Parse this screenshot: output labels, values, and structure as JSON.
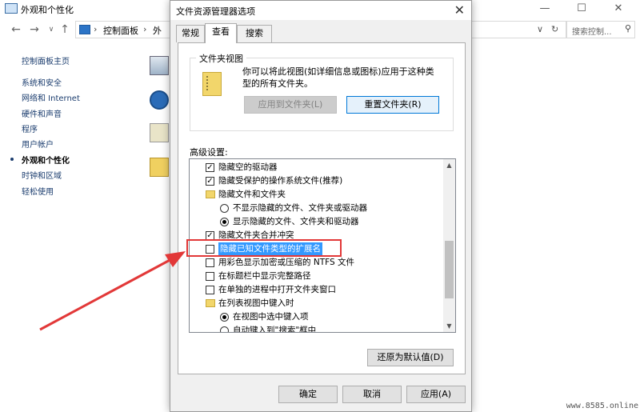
{
  "window": {
    "title": "外观和个性化",
    "minimize": "—",
    "maximize": "☐",
    "close": "✕"
  },
  "nav": {
    "back": "←",
    "forward": "→",
    "recent": "∨",
    "up": "↑",
    "crumbs": [
      "控制面板",
      "外"
    ],
    "refresh": "↻",
    "dropdown": "∨",
    "search_placeholder": "搜索控制...",
    "search_icon": "search-icon"
  },
  "sidebar": {
    "items": [
      {
        "label": "控制面板主页"
      },
      {
        "label": "系统和安全"
      },
      {
        "label": "网络和 Internet"
      },
      {
        "label": "硬件和声音"
      },
      {
        "label": "程序"
      },
      {
        "label": "用户帐户"
      },
      {
        "label": "外观和个性化",
        "active": true
      },
      {
        "label": "时钟和区域"
      },
      {
        "label": "轻松使用"
      }
    ]
  },
  "dialog": {
    "title": "文件资源管理器选项",
    "close": "✕",
    "tabs": [
      {
        "label": "常规"
      },
      {
        "label": "查看",
        "active": true
      },
      {
        "label": "搜索"
      }
    ],
    "folder_views": {
      "legend": "文件夹视图",
      "description": "你可以将此视图(如详细信息或图标)应用于这种类型的所有文件夹。",
      "apply_button": "应用到文件夹(L)",
      "reset_button": "重置文件夹(R)"
    },
    "advanced_label": "高级设置:",
    "settings": [
      {
        "type": "checkbox",
        "checked": true,
        "indent": 0,
        "label": "隐藏空的驱动器"
      },
      {
        "type": "checkbox",
        "checked": true,
        "indent": 0,
        "label": "隐藏受保护的操作系统文件(推荐)"
      },
      {
        "type": "folder",
        "indent": 0,
        "label": "隐藏文件和文件夹"
      },
      {
        "type": "radio",
        "checked": false,
        "indent": 1,
        "label": "不显示隐藏的文件、文件夹或驱动器"
      },
      {
        "type": "radio",
        "checked": true,
        "indent": 1,
        "label": "显示隐藏的文件、文件夹和驱动器"
      },
      {
        "type": "checkbox",
        "checked": true,
        "indent": 0,
        "label": "隐藏文件夹合并冲突"
      },
      {
        "type": "checkbox",
        "checked": false,
        "indent": 0,
        "label": "隐藏已知文件类型的扩展名",
        "selected": true
      },
      {
        "type": "checkbox",
        "checked": false,
        "indent": 0,
        "label": "用彩色显示加密或压缩的 NTFS 文件"
      },
      {
        "type": "checkbox",
        "checked": false,
        "indent": 0,
        "label": "在标题栏中显示完整路径"
      },
      {
        "type": "checkbox",
        "checked": false,
        "indent": 0,
        "label": "在单独的进程中打开文件夹窗口"
      },
      {
        "type": "folder",
        "indent": 0,
        "label": "在列表视图中键入时"
      },
      {
        "type": "radio",
        "checked": true,
        "indent": 1,
        "label": "在视图中选中键入项"
      },
      {
        "type": "radio",
        "checked": false,
        "indent": 1,
        "label": "自动键入到\"搜索\"框中"
      }
    ],
    "restore_button": "还原为默认值(D)",
    "ok_button": "确定",
    "cancel_button": "取消",
    "apply_button": "应用(A)"
  },
  "annotation": {
    "arrow_color": "#e23838",
    "highlight_color": "#e23838"
  },
  "watermark": "www.8585.online"
}
